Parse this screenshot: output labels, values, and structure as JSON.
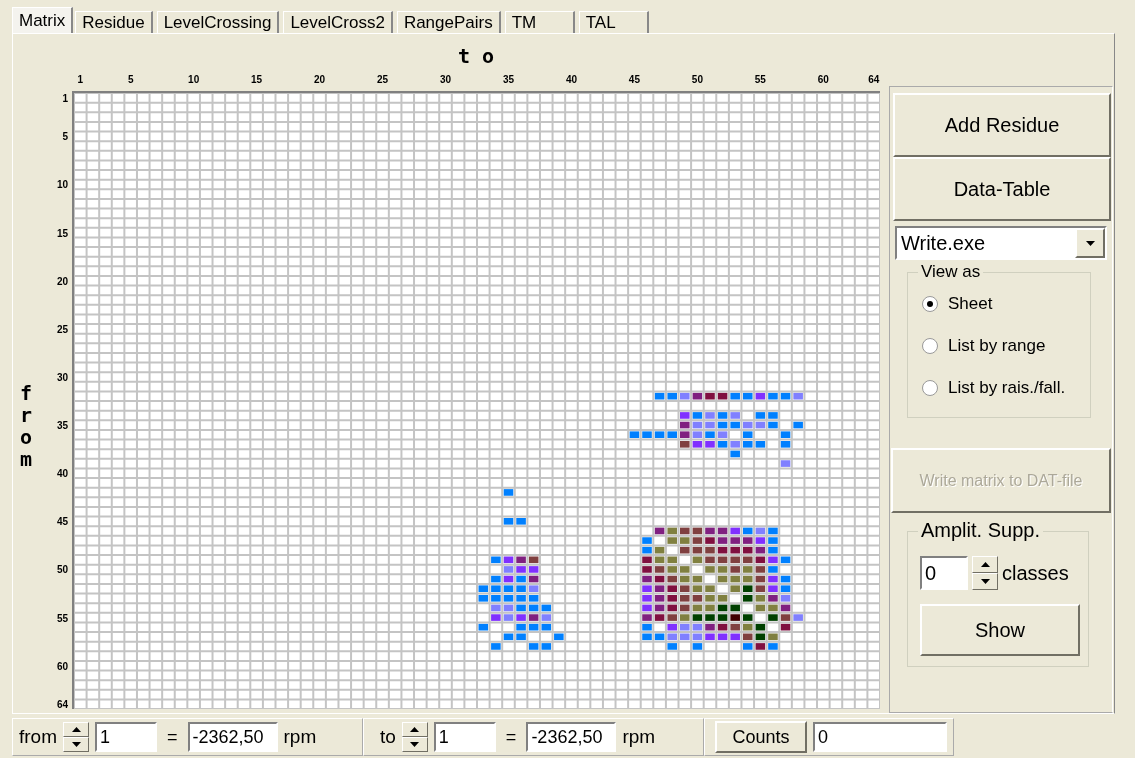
{
  "tabs": [
    {
      "label": "Matrix",
      "selected": true
    },
    {
      "label": "Residue",
      "selected": false
    },
    {
      "label": "LevelCrossing",
      "selected": false
    },
    {
      "label": "LevelCross2",
      "selected": false
    },
    {
      "label": "RangePairs",
      "selected": false
    },
    {
      "label": "TM",
      "selected": false
    },
    {
      "label": "TAL",
      "selected": false
    }
  ],
  "matrix": {
    "x_title": "t o",
    "y_title": "from",
    "x_ticks": [
      "1",
      "5",
      "10",
      "15",
      "20",
      "25",
      "30",
      "35",
      "40",
      "45",
      "50",
      "55",
      "60",
      "64"
    ],
    "y_ticks": [
      "1",
      "5",
      "10",
      "15",
      "20",
      "25",
      "30",
      "35",
      "40",
      "45",
      "50",
      "55",
      "60",
      "64"
    ],
    "rows": [
      null,
      null,
      null,
      null,
      null,
      null,
      null,
      null,
      null,
      null,
      null,
      null,
      null,
      null,
      null,
      null,
      null,
      null,
      null,
      null,
      null,
      null,
      null,
      null,
      null,
      null,
      null,
      null,
      null,
      null,
      null,
      [
        null,
        null,
        null,
        null,
        null,
        null,
        null,
        null,
        null,
        null,
        null,
        null,
        null,
        null,
        null,
        null,
        null,
        null,
        null,
        null,
        null,
        null,
        null,
        null,
        null,
        null,
        null,
        null,
        null,
        null,
        null,
        null,
        null,
        null,
        null,
        null,
        null,
        null,
        null,
        null,
        null,
        null,
        null,
        null,
        null,
        null,
        {
          "color": "#0080ff"
        },
        {
          "color": "#0080ff"
        },
        {
          "color": "#8080ff"
        },
        {
          "color": "#802080"
        },
        {
          "color": "#801040"
        },
        {
          "color": "#801040"
        },
        {
          "color": "#0080ff"
        },
        {
          "color": "#0080ff"
        },
        {
          "color": "#8030ff"
        },
        {
          "color": "#0080ff"
        },
        {
          "color": "#0080ff"
        },
        {
          "color": "#8080ff"
        }
      ],
      null,
      [
        null,
        null,
        null,
        null,
        null,
        null,
        null,
        null,
        null,
        null,
        null,
        null,
        null,
        null,
        null,
        null,
        null,
        null,
        null,
        null,
        null,
        null,
        null,
        null,
        null,
        null,
        null,
        null,
        null,
        null,
        null,
        null,
        null,
        null,
        null,
        null,
        null,
        null,
        null,
        null,
        null,
        null,
        null,
        null,
        null,
        null,
        null,
        null,
        {
          "color": "#8030ff"
        },
        {
          "color": "#0080ff"
        },
        {
          "color": "#8080ff"
        },
        {
          "color": "#0080ff"
        },
        {
          "color": "#8080ff"
        },
        null,
        {
          "color": "#0080ff"
        },
        {
          "color": "#0080ff"
        }
      ],
      [
        null,
        null,
        null,
        null,
        null,
        null,
        null,
        null,
        null,
        null,
        null,
        null,
        null,
        null,
        null,
        null,
        null,
        null,
        null,
        null,
        null,
        null,
        null,
        null,
        null,
        null,
        null,
        null,
        null,
        null,
        null,
        null,
        null,
        null,
        null,
        null,
        null,
        null,
        null,
        null,
        null,
        null,
        null,
        null,
        null,
        null,
        null,
        null,
        {
          "color": "#802080"
        },
        {
          "color": "#8080ff"
        },
        {
          "color": "#8080ff"
        },
        {
          "color": "#0080ff"
        },
        {
          "color": "#0080ff"
        },
        {
          "color": "#8080ff"
        },
        {
          "color": "#8080ff"
        },
        {
          "color": "#0080ff"
        },
        null,
        {
          "color": "#0080ff"
        }
      ],
      [
        null,
        null,
        null,
        null,
        null,
        null,
        null,
        null,
        null,
        null,
        null,
        null,
        null,
        null,
        null,
        null,
        null,
        null,
        null,
        null,
        null,
        null,
        null,
        null,
        null,
        null,
        null,
        null,
        null,
        null,
        null,
        null,
        null,
        null,
        null,
        null,
        null,
        null,
        null,
        null,
        null,
        null,
        null,
        null,
        {
          "color": "#0080ff"
        },
        {
          "color": "#0080ff"
        },
        {
          "color": "#0080ff"
        },
        {
          "color": "#0080ff"
        },
        {
          "color": "#802080"
        },
        {
          "color": "#8080ff"
        },
        {
          "color": "#0080ff"
        },
        {
          "color": "#8080ff"
        },
        null,
        {
          "color": "#0080ff"
        },
        null,
        null,
        {
          "color": "#0080ff"
        }
      ],
      [
        null,
        null,
        null,
        null,
        null,
        null,
        null,
        null,
        null,
        null,
        null,
        null,
        null,
        null,
        null,
        null,
        null,
        null,
        null,
        null,
        null,
        null,
        null,
        null,
        null,
        null,
        null,
        null,
        null,
        null,
        null,
        null,
        null,
        null,
        null,
        null,
        null,
        null,
        null,
        null,
        null,
        null,
        null,
        null,
        null,
        null,
        null,
        null,
        {
          "color": "#804040"
        },
        {
          "color": "#8030ff"
        },
        {
          "color": "#8030ff"
        },
        {
          "color": "#0080ff"
        },
        {
          "color": "#8080ff"
        },
        {
          "color": "#0080ff"
        },
        {
          "color": "#0080ff"
        },
        null,
        {
          "color": "#0080ff"
        }
      ],
      [
        null,
        null,
        null,
        null,
        null,
        null,
        null,
        null,
        null,
        null,
        null,
        null,
        null,
        null,
        null,
        null,
        null,
        null,
        null,
        null,
        null,
        null,
        null,
        null,
        null,
        null,
        null,
        null,
        null,
        null,
        null,
        null,
        null,
        null,
        null,
        null,
        null,
        null,
        null,
        null,
        null,
        null,
        null,
        null,
        null,
        null,
        null,
        null,
        null,
        null,
        null,
        null,
        {
          "color": "#0080ff"
        }
      ],
      [
        null,
        null,
        null,
        null,
        null,
        null,
        null,
        null,
        null,
        null,
        null,
        null,
        null,
        null,
        null,
        null,
        null,
        null,
        null,
        null,
        null,
        null,
        null,
        null,
        null,
        null,
        null,
        null,
        null,
        null,
        null,
        null,
        null,
        null,
        null,
        null,
        null,
        null,
        null,
        null,
        null,
        null,
        null,
        null,
        null,
        null,
        null,
        null,
        null,
        null,
        null,
        null,
        null,
        null,
        null,
        null,
        {
          "color": "#8080ff"
        }
      ],
      null,
      null,
      [
        null,
        null,
        null,
        null,
        null,
        null,
        null,
        null,
        null,
        null,
        null,
        null,
        null,
        null,
        null,
        null,
        null,
        null,
        null,
        null,
        null,
        null,
        null,
        null,
        null,
        null,
        null,
        null,
        null,
        null,
        null,
        null,
        null,
        null,
        {
          "color": "#0080ff"
        }
      ],
      null,
      null,
      [
        null,
        null,
        null,
        null,
        null,
        null,
        null,
        null,
        null,
        null,
        null,
        null,
        null,
        null,
        null,
        null,
        null,
        null,
        null,
        null,
        null,
        null,
        null,
        null,
        null,
        null,
        null,
        null,
        null,
        null,
        null,
        null,
        null,
        null,
        {
          "color": "#0080ff"
        },
        {
          "color": "#0080ff"
        }
      ],
      [
        null,
        null,
        null,
        null,
        null,
        null,
        null,
        null,
        null,
        null,
        null,
        null,
        null,
        null,
        null,
        null,
        null,
        null,
        null,
        null,
        null,
        null,
        null,
        null,
        null,
        null,
        null,
        null,
        null,
        null,
        null,
        null,
        null,
        null,
        null,
        null,
        null,
        null,
        null,
        null,
        null,
        null,
        null,
        null,
        null,
        null,
        {
          "color": "#802080"
        },
        {
          "color": "#808040"
        },
        {
          "color": "#804040"
        },
        {
          "color": "#804040"
        },
        {
          "color": "#802080"
        },
        {
          "color": "#802080"
        },
        {
          "color": "#8030ff"
        },
        {
          "color": "#0080ff"
        },
        {
          "color": "#8080ff"
        },
        {
          "color": "#0080ff"
        }
      ],
      [
        null,
        null,
        null,
        null,
        null,
        null,
        null,
        null,
        null,
        null,
        null,
        null,
        null,
        null,
        null,
        null,
        null,
        null,
        null,
        null,
        null,
        null,
        null,
        null,
        null,
        null,
        null,
        null,
        null,
        null,
        null,
        null,
        null,
        null,
        null,
        null,
        null,
        null,
        null,
        null,
        null,
        null,
        null,
        null,
        null,
        {
          "color": "#0080ff"
        },
        null,
        {
          "color": "#808040"
        },
        {
          "color": "#808040"
        },
        {
          "color": "#804040"
        },
        {
          "color": "#801040"
        },
        {
          "color": "#802080"
        },
        {
          "color": "#802080"
        },
        {
          "color": "#802080"
        },
        {
          "color": "#8030ff"
        },
        {
          "color": "#0080ff"
        }
      ],
      [
        null,
        null,
        null,
        null,
        null,
        null,
        null,
        null,
        null,
        null,
        null,
        null,
        null,
        null,
        null,
        null,
        null,
        null,
        null,
        null,
        null,
        null,
        null,
        null,
        null,
        null,
        null,
        null,
        null,
        null,
        null,
        null,
        null,
        null,
        null,
        null,
        null,
        null,
        null,
        null,
        null,
        null,
        null,
        null,
        null,
        {
          "color": "#0080ff"
        },
        {
          "color": "#808040"
        },
        null,
        {
          "color": "#804040"
        },
        {
          "color": "#804040"
        },
        {
          "color": "#804040"
        },
        {
          "color": "#801040"
        },
        {
          "color": "#801040"
        },
        {
          "color": "#801040"
        },
        {
          "color": "#802080"
        },
        {
          "color": "#0080ff"
        }
      ],
      [
        null,
        null,
        null,
        null,
        null,
        null,
        null,
        null,
        null,
        null,
        null,
        null,
        null,
        null,
        null,
        null,
        null,
        null,
        null,
        null,
        null,
        null,
        null,
        null,
        null,
        null,
        null,
        null,
        null,
        null,
        null,
        null,
        null,
        {
          "color": "#0080ff"
        },
        {
          "color": "#8030ff"
        },
        {
          "color": "#802080"
        },
        {
          "color": "#804040"
        },
        null,
        null,
        null,
        null,
        null,
        null,
        null,
        null,
        {
          "color": "#801040"
        },
        {
          "color": "#808040"
        },
        {
          "color": "#808040"
        },
        null,
        {
          "color": "#808040"
        },
        {
          "color": "#804040"
        },
        {
          "color": "#804040"
        },
        {
          "color": "#804040"
        },
        {
          "color": "#804040"
        },
        {
          "color": "#801040"
        },
        {
          "color": "#8030ff"
        },
        {
          "color": "#0080ff"
        }
      ],
      [
        null,
        null,
        null,
        null,
        null,
        null,
        null,
        null,
        null,
        null,
        null,
        null,
        null,
        null,
        null,
        null,
        null,
        null,
        null,
        null,
        null,
        null,
        null,
        null,
        null,
        null,
        null,
        null,
        null,
        null,
        null,
        null,
        null,
        null,
        {
          "color": "#8080ff"
        },
        {
          "color": "#8030ff"
        },
        {
          "color": "#8030ff"
        },
        null,
        null,
        null,
        null,
        null,
        null,
        null,
        null,
        {
          "color": "#801040"
        },
        {
          "color": "#804040"
        },
        {
          "color": "#808040"
        },
        {
          "color": "#808040"
        },
        null,
        {
          "color": "#808040"
        },
        {
          "color": "#808040"
        },
        {
          "color": "#804040"
        },
        {
          "color": "#808040"
        },
        {
          "color": "#804040"
        },
        {
          "color": "#0080ff"
        }
      ],
      [
        null,
        null,
        null,
        null,
        null,
        null,
        null,
        null,
        null,
        null,
        null,
        null,
        null,
        null,
        null,
        null,
        null,
        null,
        null,
        null,
        null,
        null,
        null,
        null,
        null,
        null,
        null,
        null,
        null,
        null,
        null,
        null,
        null,
        {
          "color": "#0080ff"
        },
        {
          "color": "#8030ff"
        },
        {
          "color": "#0080ff"
        },
        {
          "color": "#802080"
        },
        null,
        null,
        null,
        null,
        null,
        null,
        null,
        null,
        {
          "color": "#802080"
        },
        {
          "color": "#801040"
        },
        {
          "color": "#804040"
        },
        {
          "color": "#808040"
        },
        {
          "color": "#808040"
        },
        null,
        {
          "color": "#808040"
        },
        {
          "color": "#808040"
        },
        {
          "color": "#808040"
        },
        {
          "color": "#804040"
        },
        {
          "color": "#8030ff"
        },
        {
          "color": "#0080ff"
        }
      ],
      [
        null,
        null,
        null,
        null,
        null,
        null,
        null,
        null,
        null,
        null,
        null,
        null,
        null,
        null,
        null,
        null,
        null,
        null,
        null,
        null,
        null,
        null,
        null,
        null,
        null,
        null,
        null,
        null,
        null,
        null,
        null,
        null,
        {
          "color": "#0080ff"
        },
        {
          "color": "#0080ff"
        },
        {
          "color": "#0080ff"
        },
        {
          "color": "#0080ff"
        },
        {
          "color": "#8080ff"
        },
        null,
        null,
        null,
        null,
        null,
        null,
        null,
        null,
        {
          "color": "#8030ff"
        },
        {
          "color": "#802080"
        },
        {
          "color": "#801040"
        },
        {
          "color": "#804040"
        },
        {
          "color": "#808040"
        },
        {
          "color": "#808040"
        },
        null,
        {
          "color": "#808040"
        },
        {
          "color": "#004000"
        },
        {
          "color": "#804040"
        },
        {
          "color": "#8030ff"
        },
        {
          "color": "#0080ff"
        }
      ],
      [
        null,
        null,
        null,
        null,
        null,
        null,
        null,
        null,
        null,
        null,
        null,
        null,
        null,
        null,
        null,
        null,
        null,
        null,
        null,
        null,
        null,
        null,
        null,
        null,
        null,
        null,
        null,
        null,
        null,
        null,
        null,
        null,
        {
          "color": "#0080ff"
        },
        {
          "color": "#0080ff"
        },
        {
          "color": "#0080ff"
        },
        {
          "color": "#0080ff"
        },
        {
          "color": "#0080ff"
        },
        null,
        null,
        null,
        null,
        null,
        null,
        null,
        null,
        {
          "color": "#8030ff"
        },
        {
          "color": "#802080"
        },
        {
          "color": "#801040"
        },
        {
          "color": "#804040"
        },
        {
          "color": "#804040"
        },
        {
          "color": "#808040"
        },
        {
          "color": "#808040"
        },
        null,
        {
          "color": "#004000"
        },
        {
          "color": "#808040"
        },
        {
          "color": "#802080"
        },
        {
          "color": "#8080ff"
        }
      ],
      [
        null,
        null,
        null,
        null,
        null,
        null,
        null,
        null,
        null,
        null,
        null,
        null,
        null,
        null,
        null,
        null,
        null,
        null,
        null,
        null,
        null,
        null,
        null,
        null,
        null,
        null,
        null,
        null,
        null,
        null,
        null,
        null,
        null,
        {
          "color": "#8080ff"
        },
        {
          "color": "#8080ff"
        },
        {
          "color": "#0080ff"
        },
        {
          "color": "#0080ff"
        },
        {
          "color": "#0080ff"
        },
        null,
        null,
        null,
        null,
        null,
        null,
        null,
        {
          "color": "#8030ff"
        },
        {
          "color": "#802080"
        },
        {
          "color": "#801040"
        },
        {
          "color": "#804040"
        },
        {
          "color": "#808040"
        },
        {
          "color": "#808040"
        },
        {
          "color": "#004000"
        },
        {
          "color": "#004000"
        },
        null,
        {
          "color": "#808040"
        },
        {
          "color": "#808040"
        },
        {
          "color": "#802080"
        }
      ],
      [
        null,
        null,
        null,
        null,
        null,
        null,
        null,
        null,
        null,
        null,
        null,
        null,
        null,
        null,
        null,
        null,
        null,
        null,
        null,
        null,
        null,
        null,
        null,
        null,
        null,
        null,
        null,
        null,
        null,
        null,
        null,
        null,
        null,
        {
          "color": "#8030ff"
        },
        {
          "color": "#8080ff"
        },
        {
          "color": "#8030ff"
        },
        {
          "color": "#802080"
        },
        {
          "color": "#8080ff"
        },
        null,
        null,
        null,
        null,
        null,
        null,
        null,
        {
          "color": "#802080"
        },
        {
          "color": "#801040"
        },
        {
          "color": "#804040"
        },
        {
          "color": "#808040"
        },
        {
          "color": "#004000"
        },
        {
          "color": "#004000"
        },
        {
          "color": "#004000"
        },
        {
          "color": "#400000"
        },
        {
          "color": "#004000"
        },
        null,
        {
          "color": "#004000"
        },
        {
          "color": "#804040"
        },
        {
          "color": "#8080ff"
        }
      ],
      [
        null,
        null,
        null,
        null,
        null,
        null,
        null,
        null,
        null,
        null,
        null,
        null,
        null,
        null,
        null,
        null,
        null,
        null,
        null,
        null,
        null,
        null,
        null,
        null,
        null,
        null,
        null,
        null,
        null,
        null,
        null,
        null,
        {
          "color": "#0080ff"
        },
        null,
        null,
        {
          "color": "#0080ff"
        },
        {
          "color": "#0080ff"
        },
        {
          "color": "#0080ff"
        },
        null,
        null,
        null,
        null,
        null,
        null,
        null,
        {
          "color": "#0080ff"
        },
        null,
        {
          "color": "#8030ff"
        },
        {
          "color": "#8080ff"
        },
        {
          "color": "#8080ff"
        },
        {
          "color": "#802080"
        },
        {
          "color": "#801040"
        },
        {
          "color": "#804040"
        },
        {
          "color": "#808040"
        },
        {
          "color": "#004000"
        },
        null,
        {
          "color": "#801040"
        }
      ],
      [
        null,
        null,
        null,
        null,
        null,
        null,
        null,
        null,
        null,
        null,
        null,
        null,
        null,
        null,
        null,
        null,
        null,
        null,
        null,
        null,
        null,
        null,
        null,
        null,
        null,
        null,
        null,
        null,
        null,
        null,
        null,
        null,
        null,
        null,
        {
          "color": "#0080ff"
        },
        {
          "color": "#0080ff"
        },
        null,
        null,
        {
          "color": "#0080ff"
        },
        null,
        null,
        null,
        null,
        null,
        null,
        {
          "color": "#0080ff"
        },
        {
          "color": "#0080ff"
        },
        {
          "color": "#8080ff"
        },
        {
          "color": "#8080ff"
        },
        {
          "color": "#8080ff"
        },
        {
          "color": "#8030ff"
        },
        {
          "color": "#8030ff"
        },
        {
          "color": "#8030ff"
        },
        {
          "color": "#804040"
        },
        {
          "color": "#004000"
        },
        {
          "color": "#808040"
        }
      ],
      [
        null,
        null,
        null,
        null,
        null,
        null,
        null,
        null,
        null,
        null,
        null,
        null,
        null,
        null,
        null,
        null,
        null,
        null,
        null,
        null,
        null,
        null,
        null,
        null,
        null,
        null,
        null,
        null,
        null,
        null,
        null,
        null,
        null,
        {
          "color": "#0080ff"
        },
        null,
        null,
        {
          "color": "#0080ff"
        },
        {
          "color": "#0080ff"
        },
        null,
        null,
        null,
        null,
        null,
        null,
        null,
        null,
        null,
        {
          "color": "#0080ff"
        },
        null,
        {
          "color": "#0080ff"
        },
        null,
        null,
        null,
        {
          "color": "#0080ff"
        },
        {
          "color": "#801040"
        },
        {
          "color": "#0080ff"
        }
      ]
    ]
  },
  "side": {
    "add_button": "Add Residue",
    "table_button": "Data-Table",
    "program_select": {
      "value": "Write.exe"
    },
    "view_group": {
      "title": "View as",
      "options": [
        {
          "label": "Sheet",
          "selected": true
        },
        {
          "label": "List by range",
          "selected": false
        },
        {
          "label": "List by rais./fall.",
          "selected": false
        }
      ]
    },
    "write_button": {
      "label": "Write matrix to DAT-file",
      "disabled": true
    },
    "suppression": {
      "title": "Amplit. Supp.",
      "value": "0",
      "unit": "classes",
      "button": "Show"
    }
  },
  "bottom": {
    "from": {
      "label": "from",
      "index": "1",
      "equals": "=",
      "value": "-2362,50",
      "unit": "rpm"
    },
    "to": {
      "label": "to",
      "index": "1",
      "equals": "=",
      "value": "-2362,50",
      "unit": "rpm"
    },
    "counts": {
      "button": "Counts",
      "value": "0"
    }
  }
}
